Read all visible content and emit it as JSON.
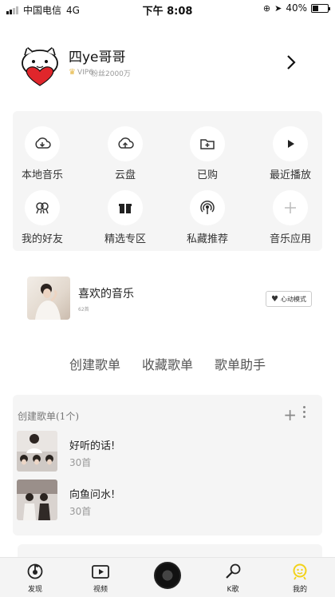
{
  "status_bar": {
    "carrier": "中国电信",
    "network": "4G",
    "time": "下午 8:08",
    "battery": "40%",
    "battery_level": 0.4
  },
  "profile": {
    "name": "四ye哥哥",
    "vip": "VIP6",
    "fans": "粉丝2000万"
  },
  "grid": [
    {
      "label": "本地音乐",
      "icon": "download-icon"
    },
    {
      "label": "云盘",
      "icon": "cloud-upload-icon"
    },
    {
      "label": "已购",
      "icon": "folder-plus-icon"
    },
    {
      "label": "最近播放",
      "icon": "play-icon"
    },
    {
      "label": "我的好友",
      "icon": "friends-icon"
    },
    {
      "label": "精选专区",
      "icon": "gift-box-icon"
    },
    {
      "label": "私藏推荐",
      "icon": "broadcast-icon"
    },
    {
      "label": "音乐应用",
      "icon": "plus-icon"
    }
  ],
  "favorite": {
    "title": "喜欢的音乐",
    "count": "62首",
    "heart_mode": "心动模式"
  },
  "tabs": [
    "创建歌单",
    "收藏歌单",
    "歌单助手"
  ],
  "created_playlists": {
    "header": "创建歌单(1个)",
    "items": [
      {
        "name": "好听的话!",
        "count": "30首"
      },
      {
        "name": "向鱼问水!",
        "count": "30首"
      }
    ]
  },
  "tabbar": [
    {
      "label": "发现",
      "icon": "discover-icon"
    },
    {
      "label": "视频",
      "icon": "video-icon"
    },
    {
      "label": "K歌",
      "icon": "microphone-icon"
    },
    {
      "label": "我的",
      "icon": "my-icon"
    }
  ],
  "colors": {
    "card_bg": "#f5f5f5",
    "active_tab": "#f2d21a",
    "vip_gold": "#e6b94a"
  }
}
